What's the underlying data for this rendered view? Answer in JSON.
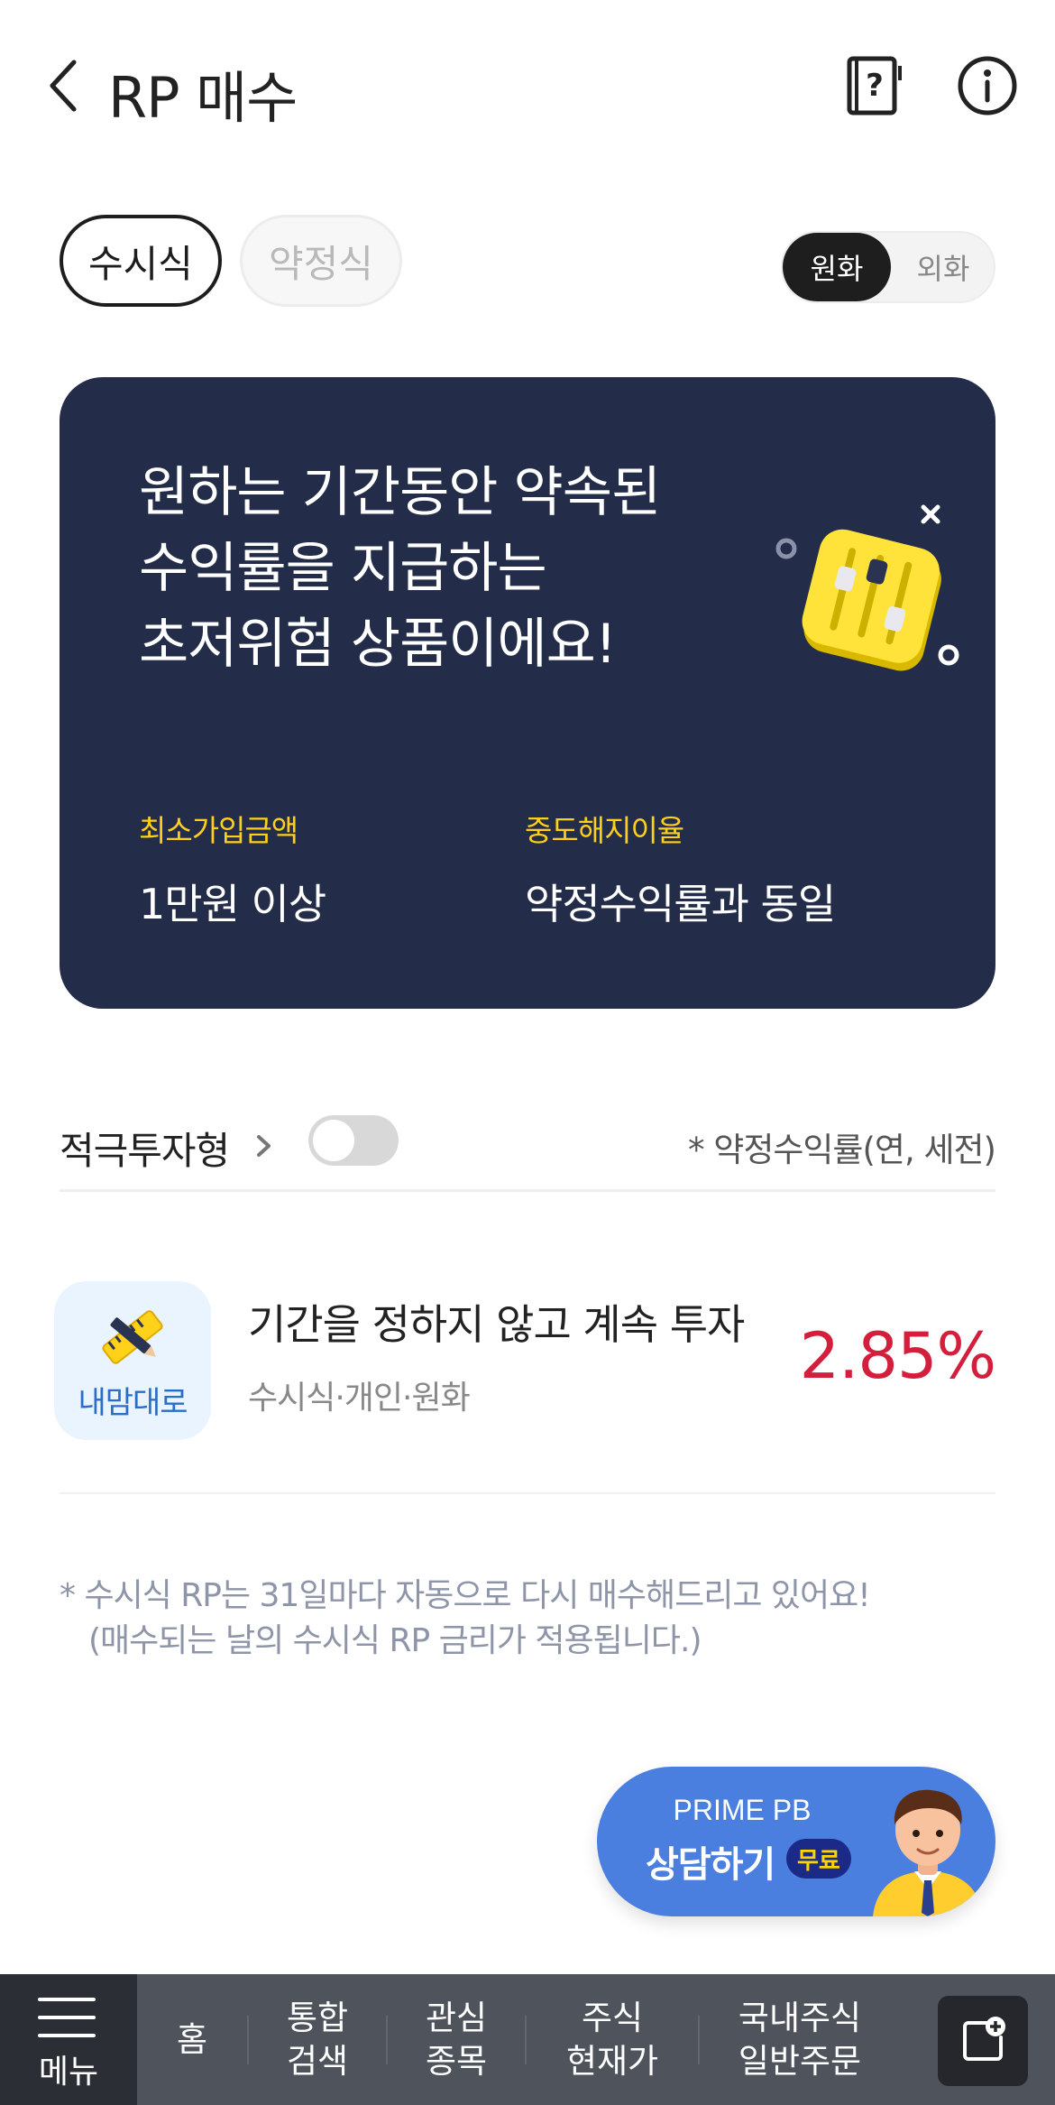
{
  "header": {
    "title": "RP 매수",
    "back_icon": "chevron-left-icon",
    "guide_icon": "book-question-icon",
    "info_icon": "info-circle-icon"
  },
  "type_tabs": [
    {
      "label": "수시식",
      "selected": true
    },
    {
      "label": "약정식",
      "selected": false
    }
  ],
  "currency_tabs": [
    {
      "label": "원화",
      "selected": true
    },
    {
      "label": "외화",
      "selected": false
    }
  ],
  "banner": {
    "headline": [
      "원하는 기간동안 약속된",
      "수익률을 지급하는",
      "초저위험 상품이에요!"
    ],
    "illustration_icon": "slider-controls-icon",
    "stats": [
      {
        "label": "최소가입금액",
        "value": "1만원 이상"
      },
      {
        "label": "중도해지이율",
        "value": "약정수익률과 동일"
      }
    ],
    "colors": {
      "background": "#232c48",
      "label": "#ffcf1a"
    }
  },
  "filter": {
    "label": "적극투자형",
    "toggle_on": false,
    "rate_note": "* 약정수익률(연, 세전)"
  },
  "products": [
    {
      "icon_label": "내맘대로",
      "icon": "ruler-pencil-icon",
      "title": "기간을 정하지 않고 계속 투자",
      "subtitle": "수시식·개인·원화",
      "rate": "2.85%",
      "rate_color": "#d31f3c"
    }
  ],
  "footnote": [
    "* 수시식 RP는 31일마다 자동으로 다시 매수해드리고 있어요!",
    "(매수되는 날의 수시식 RP 금리가 적용됩니다.)"
  ],
  "consult": {
    "line1": "PRIME PB",
    "line2": "상담하기",
    "badge": "무료",
    "avatar_icon": "advisor-avatar-icon",
    "color": "#4a7fe0"
  },
  "bottom_nav": {
    "menu_label": "메뉴",
    "items": [
      "홈",
      "통합\n검색",
      "관심\n종목",
      "주식\n현재가",
      "국내주식\n일반주문"
    ],
    "action_icon": "add-window-icon"
  }
}
